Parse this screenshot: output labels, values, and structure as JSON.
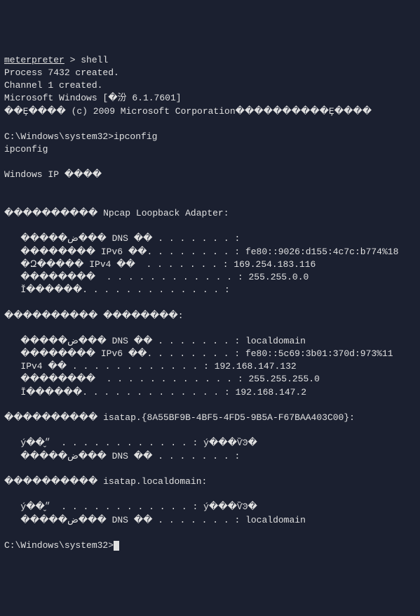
{
  "terminal": {
    "meterpreter_prompt": "meterpreter",
    "prompt_suffix": " > ",
    "shell_cmd": "shell",
    "process_created": "Process 7432 created.",
    "channel_created": "Channel 1 created.",
    "windows_version": "Microsoft Windows [�汾 6.1.7601]",
    "copyright": "��Ȩ���� (c) 2009 Microsoft Corporation����������Ȩ����",
    "blank1": "",
    "cmd_prompt1": "C:\\Windows\\system32>",
    "ipconfig_cmd": "ipconfig",
    "ipconfig_echo": "ipconfig",
    "blank2": "",
    "windows_ip": "Windows IP ����",
    "blank3": "",
    "blank4": "",
    "adapter1_header": "���������� Npcap Loopback Adapter:",
    "blank5": "",
    "adapter1_dns": "   �����ض��� DNS ��׺ . . . . . . . :",
    "adapter1_ipv6": "   �������� IPv6 ��. . . . . . . . : fe80::9026:d155:4c7c:b774%18",
    "adapter1_ipv4": "   �Զ����� IPv4 ��  . . . . . . . : 169.254.183.116",
    "adapter1_mask": "   ��������  . . . . . . . . . . . . : 255.255.0.0",
    "adapter1_gateway": "   Ĭ������. . . . . . . . . . . . . :",
    "blank6": "",
    "adapter2_header": "���������� ��������:",
    "blank7": "",
    "adapter2_dns": "   �����ض��� DNS ��׺ . . . . . . . : localdomain",
    "adapter2_ipv6": "   �������� IPv6 ��. . . . . . . . : fe80::5c69:3b01:370d:973%11",
    "adapter2_ipv4": "   IPv4 �� . . . . . . . . . . . . : 192.168.147.132",
    "adapter2_mask": "   ��������  . . . . . . . . . . . . : 255.255.255.0",
    "adapter2_gateway": "   Ĭ������. . . . . . . . . . . . . : 192.168.147.2",
    "blank8": "",
    "adapter3_header": "���������� isatap.{8A55BF9B-4BF5-4FD5-9B5A-F67BAA403C00}:",
    "blank9": "",
    "adapter3_status": "   ý��״̬  . . . . . . . . . . . . : ý���ѶϿ�",
    "adapter3_dns": "   �����ض��� DNS ��׺ . . . . . . . :",
    "blank10": "",
    "adapter4_header": "���������� isatap.localdomain:",
    "blank11": "",
    "adapter4_status": "   ý��״̬  . . . . . . . . . . . . : ý���ѶϿ�",
    "adapter4_dns": "   �����ض��� DNS ��׺ . . . . . . . : localdomain",
    "blank12": "",
    "cmd_prompt2": "C:\\Windows\\system32>"
  }
}
